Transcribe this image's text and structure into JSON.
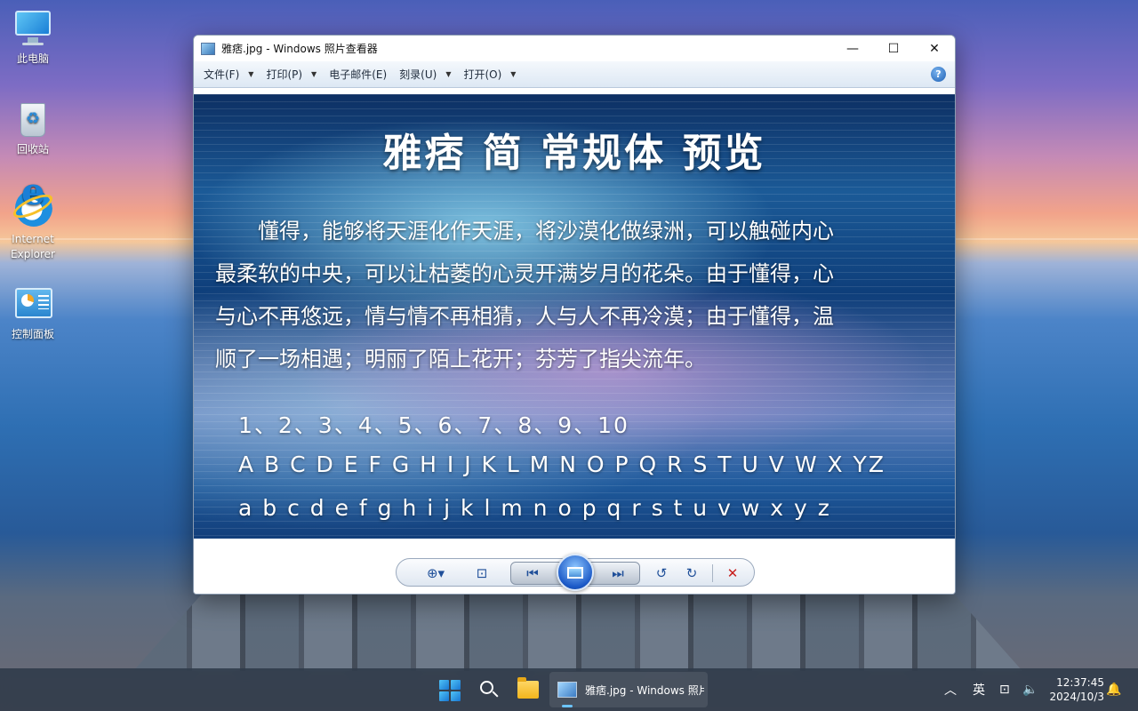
{
  "desktop": {
    "icons": [
      {
        "label": "此电脑"
      },
      {
        "label": "回收站"
      },
      {
        "label": "Internet Explorer"
      },
      {
        "label": "控制面板"
      }
    ]
  },
  "window": {
    "title": "雅痞.jpg - Windows 照片查看器",
    "controls": {
      "minimize": "—",
      "maximize": "☐",
      "close": "✕"
    },
    "menu": [
      {
        "label": "文件(F)",
        "has_dropdown": true
      },
      {
        "label": "打印(P)",
        "has_dropdown": true
      },
      {
        "label": "电子邮件(E)",
        "has_dropdown": false
      },
      {
        "label": "刻录(U)",
        "has_dropdown": true
      },
      {
        "label": "打开(O)",
        "has_dropdown": true
      }
    ],
    "help_label": "?"
  },
  "photo": {
    "title": "雅痞 简 常规体 预览",
    "lines": [
      "　　懂得，能够将天涯化作天涯，将沙漠化做绿洲，可以触碰内心",
      "最柔软的中央，可以让枯萎的心灵开满岁月的花朵。由于懂得，心",
      "与心不再悠远，情与情不再相猜，人与人不再冷漠；由于懂得，温",
      "顺了一场相遇；明丽了陌上花开；芬芳了指尖流年。"
    ],
    "numbers": "1、2、3、4、5、6、7、8、9、10",
    "upper": "A B C D E F G H I J K L M N O P Q R S T U V W X YZ",
    "lower": "a b c d e f g h i j k l m n o p q r s t u v w x y z"
  },
  "toolbar": {
    "zoom": "⊕▾",
    "fit": "⊡",
    "prev": "⏮",
    "next": "⏭",
    "rotate_ccw": "↺",
    "rotate_cw": "↻",
    "delete": "✕"
  },
  "taskbar": {
    "app_label": "雅痞.jpg - Windows 照片",
    "tray": {
      "chevron": "︿",
      "ime": "英",
      "network": "⊡",
      "volume": "🔈"
    },
    "time": "12:37:45",
    "date": "2024/10/3",
    "notification": "🔔"
  }
}
